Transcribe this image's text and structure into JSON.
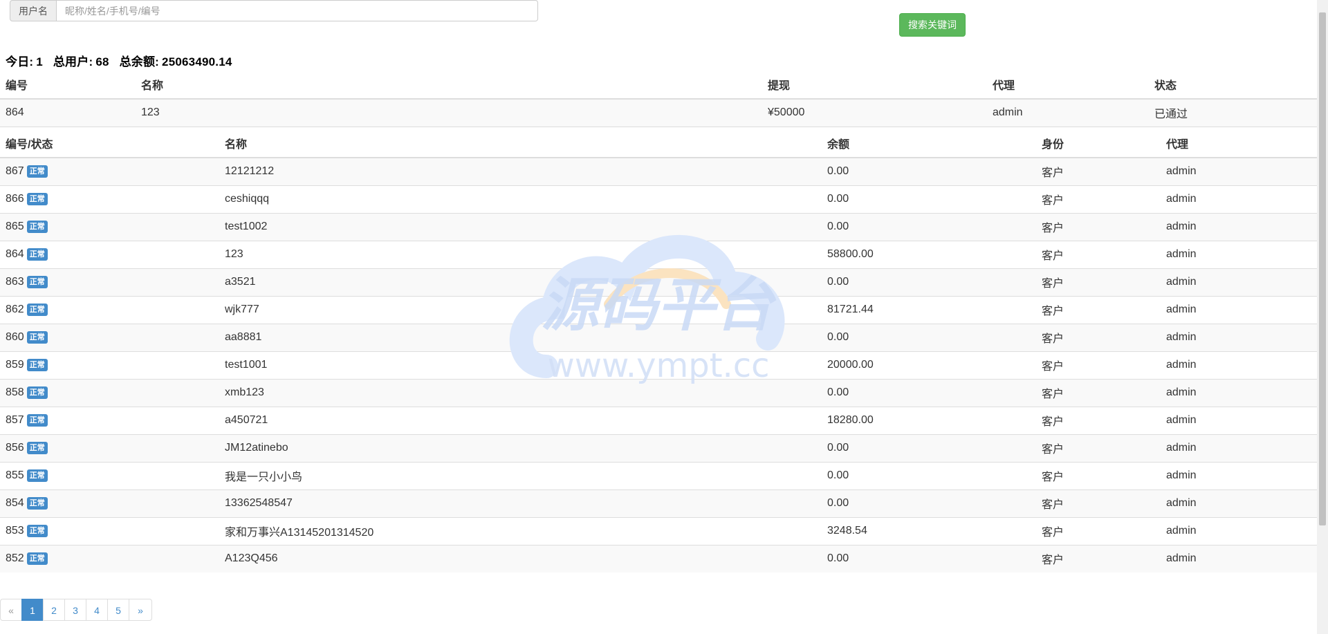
{
  "search": {
    "addon_label": "用户名",
    "placeholder": "昵称/姓名/手机号/编号",
    "value": "",
    "button_label": "搜索关键词"
  },
  "summary": {
    "today_label": "今日:",
    "today_value": "1",
    "total_users_label": "总用户:",
    "total_users_value": "68",
    "total_balance_label": "总余额:",
    "total_balance_value": "25063490.14"
  },
  "withdraw_table": {
    "headers": [
      "编号",
      "名称",
      "提现",
      "代理",
      "状态"
    ],
    "rows": [
      {
        "id": "864",
        "name": "123",
        "amount": "¥50000",
        "agent": "admin",
        "status": "已通过"
      }
    ]
  },
  "users_table": {
    "headers": [
      "编号/状态",
      "名称",
      "余额",
      "身份",
      "代理"
    ],
    "status_badge": "正常",
    "rows": [
      {
        "id": "867",
        "name": "12121212",
        "balance": "0.00",
        "role": "客户",
        "agent": "admin"
      },
      {
        "id": "866",
        "name": "ceshiqqq",
        "balance": "0.00",
        "role": "客户",
        "agent": "admin"
      },
      {
        "id": "865",
        "name": "test1002",
        "balance": "0.00",
        "role": "客户",
        "agent": "admin"
      },
      {
        "id": "864",
        "name": "123",
        "balance": "58800.00",
        "role": "客户",
        "agent": "admin"
      },
      {
        "id": "863",
        "name": "a3521",
        "balance": "0.00",
        "role": "客户",
        "agent": "admin"
      },
      {
        "id": "862",
        "name": "wjk777",
        "balance": "81721.44",
        "role": "客户",
        "agent": "admin"
      },
      {
        "id": "860",
        "name": "aa8881",
        "balance": "0.00",
        "role": "客户",
        "agent": "admin"
      },
      {
        "id": "859",
        "name": "test1001",
        "balance": "20000.00",
        "role": "客户",
        "agent": "admin"
      },
      {
        "id": "858",
        "name": "xmb123",
        "balance": "0.00",
        "role": "客户",
        "agent": "admin"
      },
      {
        "id": "857",
        "name": "a450721",
        "balance": "18280.00",
        "role": "客户",
        "agent": "admin"
      },
      {
        "id": "856",
        "name": "JM12atinebo",
        "balance": "0.00",
        "role": "客户",
        "agent": "admin"
      },
      {
        "id": "855",
        "name": "我是一只小小鸟",
        "balance": "0.00",
        "role": "客户",
        "agent": "admin"
      },
      {
        "id": "854",
        "name": "13362548547",
        "balance": "0.00",
        "role": "客户",
        "agent": "admin"
      },
      {
        "id": "853",
        "name": "家和万事兴A13145201314520",
        "balance": "3248.54",
        "role": "客户",
        "agent": "admin"
      },
      {
        "id": "852",
        "name": "A123Q456",
        "balance": "0.00",
        "role": "客户",
        "agent": "admin"
      }
    ]
  },
  "pagination": {
    "prev": "«",
    "pages": [
      "1",
      "2",
      "3",
      "4",
      "5"
    ],
    "current": "1",
    "next": "»"
  },
  "watermark": {
    "title": "源码平台",
    "url": "www.ympt.cc"
  },
  "colors": {
    "primary": "#428bca",
    "success": "#5cb85c",
    "stripe": "#f9f9f9",
    "border": "#dddddd"
  }
}
